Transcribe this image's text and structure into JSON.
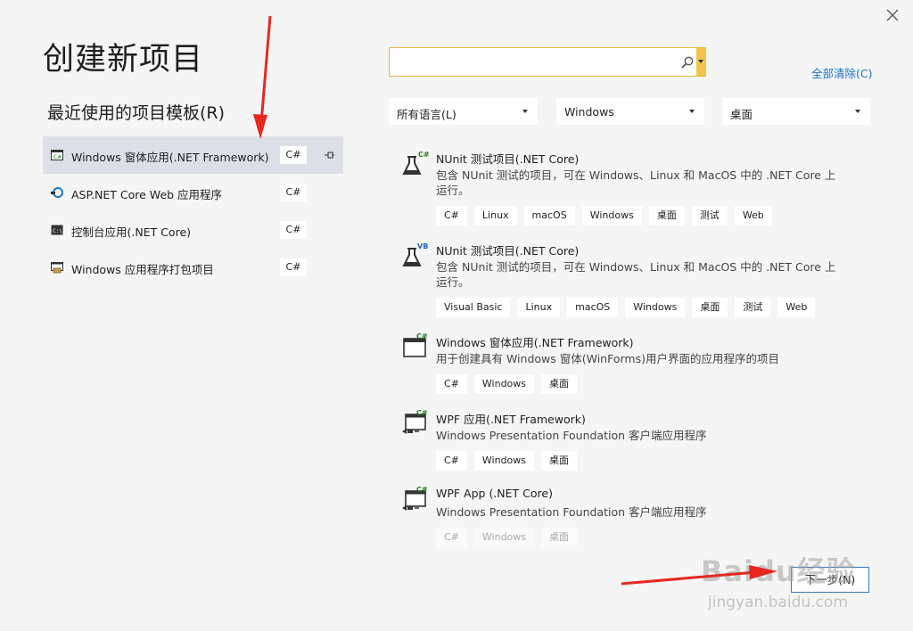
{
  "window": {
    "close_icon": "close-icon"
  },
  "page_title": "创建新项目",
  "recent": {
    "title": "最近使用的项目模板(R)",
    "items": [
      {
        "label": "Windows 窗体应用(.NET Framework)",
        "badge": "C#",
        "icon": "winforms-icon",
        "pinned": true,
        "selected": true
      },
      {
        "label": "ASP.NET Core Web 应用程序",
        "badge": "C#",
        "icon": "aspnet-icon"
      },
      {
        "label": "控制台应用(.NET Core)",
        "badge": "C#",
        "icon": "console-icon"
      },
      {
        "label": "Windows 应用程序打包项目",
        "badge": "C#",
        "icon": "package-icon"
      }
    ]
  },
  "search": {
    "value": "",
    "placeholder": ""
  },
  "clear_all": "全部清除(C)",
  "filters": {
    "language": "所有语言(L)",
    "platform": "Windows",
    "project_type": "桌面"
  },
  "templates": [
    {
      "name": "NUnit 测试项目(.NET Core)",
      "desc": "包含 NUnit 测试的项目，可在 Windows、Linux 和 MacOS 中的 .NET Core 上运行。",
      "tags": [
        "C#",
        "Linux",
        "macOS",
        "Windows",
        "桌面",
        "测试",
        "Web"
      ],
      "icon": "nunit-csharp-icon",
      "lang": "C#"
    },
    {
      "name": "NUnit 测试项目(.NET Core)",
      "desc": "包含 NUnit 测试的项目，可在 Windows、Linux 和 MacOS 中的 .NET Core 上运行。",
      "tags": [
        "Visual Basic",
        "Linux",
        "macOS",
        "Windows",
        "桌面",
        "测试",
        "Web"
      ],
      "icon": "nunit-vb-icon",
      "lang": "VB"
    },
    {
      "name": "Windows 窗体应用(.NET Framework)",
      "desc": "用于创建具有 Windows 窗体(WinForms)用户界面的应用程序的项目",
      "tags": [
        "C#",
        "Windows",
        "桌面"
      ],
      "icon": "winforms-icon",
      "lang": "C#"
    },
    {
      "name": "WPF 应用(.NET Framework)",
      "desc": "Windows Presentation Foundation 客户端应用程序",
      "tags": [
        "C#",
        "Windows",
        "桌面"
      ],
      "icon": "wpf-icon",
      "lang": "C#"
    },
    {
      "name": "WPF App (.NET Core)",
      "desc": "Windows Presentation Foundation 客户端应用程序",
      "tags": [
        "C#",
        "Windows",
        "桌面"
      ],
      "icon": "wpf-icon",
      "lang": "C#"
    }
  ],
  "next_button": "下一步(N)",
  "watermark": {
    "logo": "Baidu经验",
    "url": "jingyan.baidu.com"
  },
  "colors": {
    "accent": "#1a73c7",
    "selected_bg": "#dcdfe8",
    "search_border": "#e6b93b",
    "arrow": "#e8271f"
  }
}
